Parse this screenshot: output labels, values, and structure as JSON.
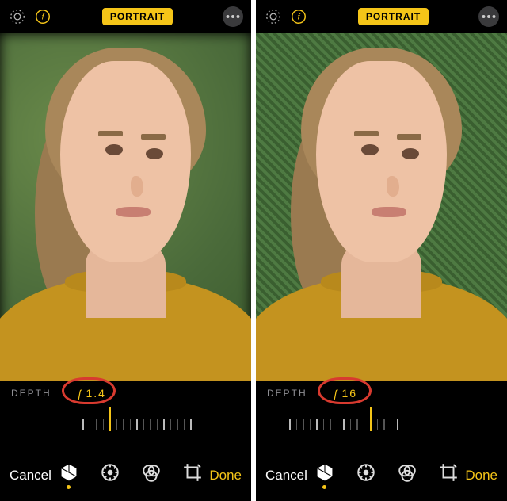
{
  "accent_color": "#f5c518",
  "screens": [
    {
      "mode_label": "PORTRAIT",
      "background": "blurred",
      "depth_section_label": "DEPTH",
      "aperture_prefix": "ƒ",
      "aperture_value": "1.4",
      "ruler": {
        "ticks": 17,
        "pointer_index": 4
      },
      "annotation_circle": true,
      "bottom": {
        "cancel": "Cancel",
        "done": "Done"
      },
      "tools": [
        {
          "name": "portrait-lighting",
          "active": true
        },
        {
          "name": "adjust",
          "active": false
        },
        {
          "name": "filters",
          "active": false
        },
        {
          "name": "crop",
          "active": false
        }
      ]
    },
    {
      "mode_label": "PORTRAIT",
      "background": "sharp",
      "depth_section_label": "DEPTH",
      "aperture_prefix": "ƒ",
      "aperture_value": "16",
      "ruler": {
        "ticks": 17,
        "pointer_index": 12
      },
      "annotation_circle": true,
      "bottom": {
        "cancel": "Cancel",
        "done": "Done"
      },
      "tools": [
        {
          "name": "portrait-lighting",
          "active": true
        },
        {
          "name": "adjust",
          "active": false
        },
        {
          "name": "filters",
          "active": false
        },
        {
          "name": "crop",
          "active": false
        }
      ]
    }
  ]
}
